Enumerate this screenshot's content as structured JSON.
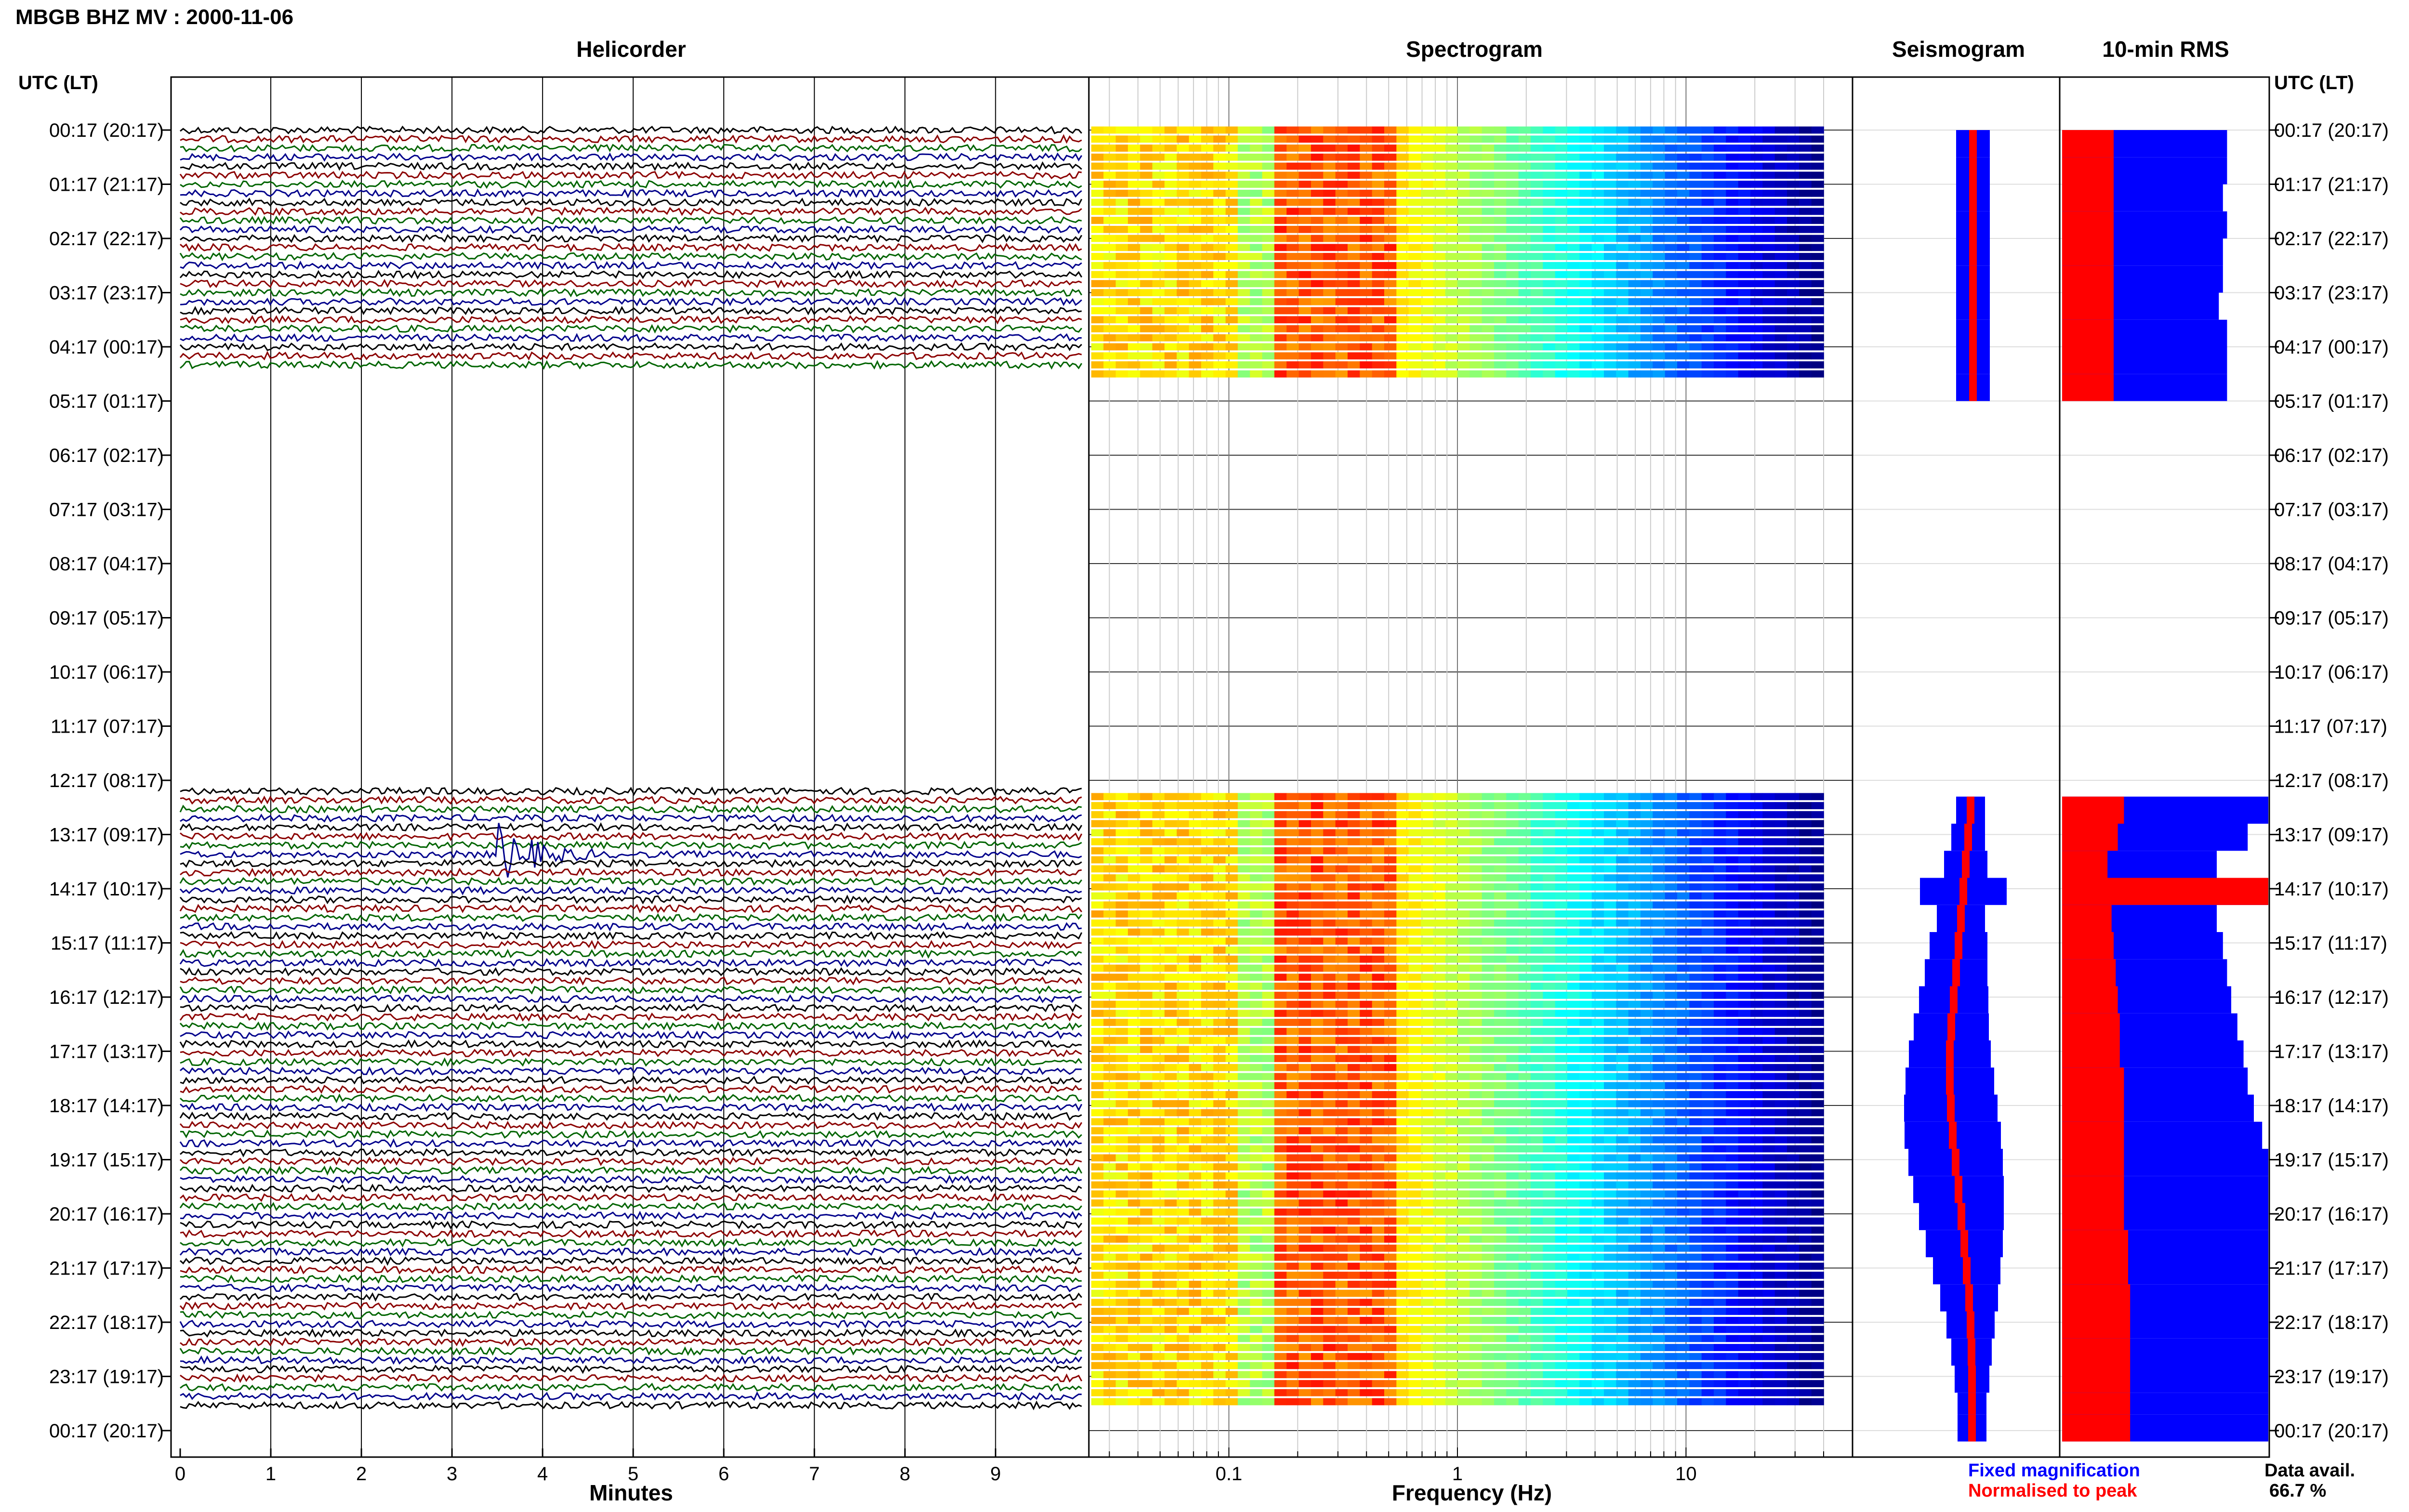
{
  "figure": {
    "main_title": "MBGB BHZ MV : 2000-11-06",
    "time_axis_label": "UTC (LT)"
  },
  "panels": {
    "helicorder": {
      "title": "Helicorder",
      "xlabel": "Minutes"
    },
    "spectrogram": {
      "title": "Spectrogram",
      "xlabel": "Frequency (Hz)"
    },
    "seismogram": {
      "title": "Seismogram"
    },
    "rms": {
      "title": "10-min RMS"
    }
  },
  "legend": {
    "fixed": "Fixed magnification",
    "normalised": "Normalised to peak",
    "fixed_color": "#0000ff",
    "normalised_color": "#ff0000"
  },
  "availability": {
    "label": "Data avail.",
    "value": "66.7 %"
  },
  "chart_data": [
    {
      "type": "line",
      "panel": "Helicorder",
      "title": "Helicorder",
      "xlabel": "Minutes",
      "x_ticks": [
        "0",
        "1",
        "2",
        "3",
        "4",
        "5",
        "6",
        "7",
        "8",
        "9"
      ],
      "xlim": [
        0,
        10
      ],
      "rows_per_hour": 6,
      "trace_colors": [
        "#000000",
        "#8b0000",
        "#006400",
        "#00008b"
      ],
      "time_labels": [
        "00:17 (20:17)",
        "01:17 (21:17)",
        "02:17 (22:17)",
        "03:17 (23:17)",
        "04:17 (00:17)",
        "05:17 (01:17)",
        "06:17 (02:17)",
        "07:17 (03:17)",
        "08:17 (04:17)",
        "09:17 (05:17)",
        "10:17 (06:17)",
        "11:17 (07:17)",
        "12:17 (08:17)",
        "13:17 (09:17)",
        "14:17 (10:17)",
        "15:17 (11:17)",
        "16:17 (12:17)",
        "17:17 (13:17)",
        "18:17 (14:17)",
        "19:17 (15:17)",
        "20:17 (16:17)",
        "21:17 (17:17)",
        "22:17 (18:17)",
        "23:17 (19:17)",
        "00:17 (20:17)"
      ],
      "data_segments": [
        {
          "from_hour": 0.0,
          "to_hour": 4.5
        },
        {
          "from_hour": 12.2,
          "to_hour": 23.7
        }
      ],
      "events": [
        {
          "hour": 13.4,
          "minute": 3.5,
          "note": "large event"
        }
      ]
    },
    {
      "type": "heatmap",
      "panel": "Spectrogram",
      "title": "Spectrogram",
      "xlabel": "Frequency (Hz)",
      "x_scale": "log",
      "x_ticks": [
        "0.1",
        "1",
        "10"
      ],
      "xlim": [
        0.025,
        40
      ],
      "colormap": "jet",
      "data_segments": [
        {
          "from_hour": 0.0,
          "to_hour": 4.6
        },
        {
          "from_hour": 12.3,
          "to_hour": 23.7
        }
      ],
      "peak_band_hz": [
        0.15,
        0.5
      ]
    },
    {
      "type": "bar",
      "panel": "Seismogram",
      "title": "Seismogram",
      "orientation": "horizontal",
      "series": [
        {
          "name": "Fixed magnification",
          "color": "#0000ff"
        },
        {
          "name": "Normalised to peak",
          "color": "#ff0000"
        }
      ],
      "hours": [
        0,
        0.5,
        1,
        1.5,
        2,
        2.5,
        3,
        3.5,
        4,
        4.5,
        12.3,
        12.8,
        13.3,
        13.8,
        14.3,
        14.8,
        15.3,
        15.8,
        16.3,
        16.8,
        17.3,
        17.8,
        18.3,
        18.8,
        19.3,
        19.8,
        20.3,
        20.8,
        21.3,
        21.8,
        22.3,
        22.8,
        23.3,
        23.7
      ],
      "fixed_half_width": [
        0.35,
        0.35,
        0.35,
        0.35,
        0.35,
        0.35,
        0.35,
        0.35,
        0.35,
        0.35,
        0.3,
        0.35,
        0.45,
        0.9,
        0.5,
        0.6,
        0.65,
        0.72,
        0.78,
        0.85,
        0.92,
        0.97,
        1.0,
        0.98,
        0.94,
        0.88,
        0.8,
        0.7,
        0.6,
        0.5,
        0.42,
        0.36,
        0.3,
        0.3
      ],
      "normalised_half_width": [
        0.08,
        0.08,
        0.08,
        0.08,
        0.08,
        0.08,
        0.08,
        0.08,
        0.08,
        0.08,
        0.08,
        0.08,
        0.08,
        0.08,
        0.08,
        0.08,
        0.08,
        0.08,
        0.08,
        0.08,
        0.08,
        0.08,
        0.08,
        0.08,
        0.08,
        0.08,
        0.08,
        0.08,
        0.08,
        0.08,
        0.08,
        0.08,
        0.08,
        0.08
      ],
      "offset": [
        0.1,
        0.1,
        0.1,
        0.1,
        0.1,
        0.1,
        0.1,
        0.1,
        0.1,
        0.1,
        0.05,
        0.0,
        -0.05,
        -0.1,
        -0.15,
        -0.2,
        -0.25,
        -0.3,
        -0.35,
        -0.38,
        -0.38,
        -0.36,
        -0.32,
        -0.26,
        -0.2,
        -0.14,
        -0.08,
        -0.03,
        0.02,
        0.05,
        0.07,
        0.08,
        0.08,
        0.08
      ]
    },
    {
      "type": "bar",
      "panel": "10-min RMS",
      "title": "10-min RMS",
      "orientation": "horizontal",
      "series": [
        {
          "name": "Fixed magnification",
          "color": "#0000ff"
        },
        {
          "name": "Normalised to peak",
          "color": "#ff0000"
        }
      ],
      "hours": [
        0,
        0.5,
        1,
        1.5,
        2,
        2.5,
        3,
        3.5,
        4,
        4.5,
        12.3,
        12.8,
        13.3,
        13.8,
        14.3,
        14.8,
        15.3,
        15.8,
        16.3,
        16.8,
        17.3,
        17.8,
        18.3,
        18.8,
        19.3,
        19.8,
        20.3,
        20.8,
        21.3,
        21.8,
        22.3,
        22.8,
        23.3,
        23.7
      ],
      "fixed_level": [
        0.8,
        0.8,
        0.78,
        0.8,
        0.78,
        0.78,
        0.76,
        0.8,
        0.8,
        0.8,
        1.0,
        0.9,
        0.75,
        1.0,
        0.75,
        0.78,
        0.8,
        0.82,
        0.85,
        0.88,
        0.9,
        0.93,
        0.97,
        1.0,
        1.0,
        1.0,
        1.0,
        1.0,
        1.0,
        1.0,
        1.0,
        1.0,
        1.0,
        1.0
      ],
      "normalised_level": [
        0.25,
        0.25,
        0.25,
        0.25,
        0.25,
        0.25,
        0.25,
        0.25,
        0.25,
        0.25,
        0.3,
        0.27,
        0.22,
        1.0,
        0.24,
        0.25,
        0.26,
        0.27,
        0.28,
        0.28,
        0.3,
        0.3,
        0.3,
        0.3,
        0.3,
        0.3,
        0.32,
        0.32,
        0.33,
        0.33,
        0.33,
        0.33,
        0.33,
        0.33
      ]
    }
  ]
}
